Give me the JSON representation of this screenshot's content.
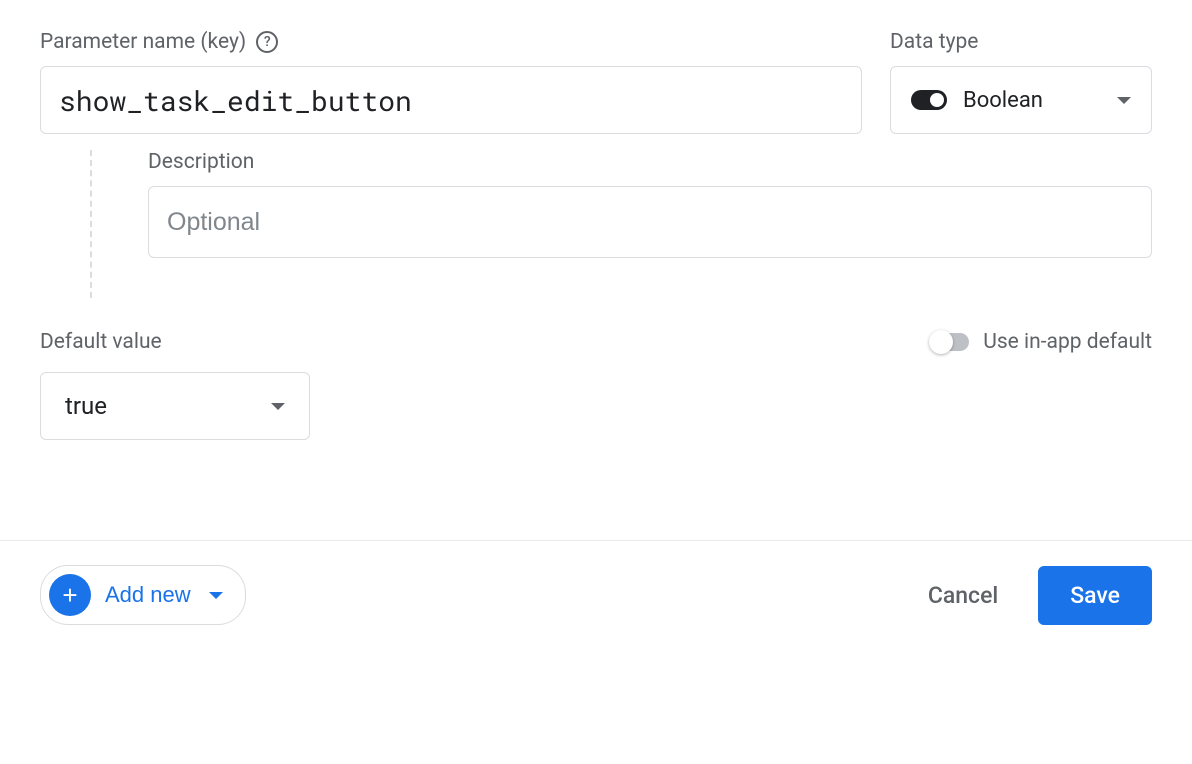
{
  "param": {
    "label": "Parameter name (key)",
    "value": "show_task_edit_button"
  },
  "datatype": {
    "label": "Data type",
    "value": "Boolean"
  },
  "description": {
    "label": "Description",
    "placeholder": "Optional",
    "value": ""
  },
  "default": {
    "label": "Default value",
    "value": "true",
    "use_inapp_label": "Use in-app default"
  },
  "footer": {
    "add_new": "Add new",
    "cancel": "Cancel",
    "save": "Save"
  }
}
